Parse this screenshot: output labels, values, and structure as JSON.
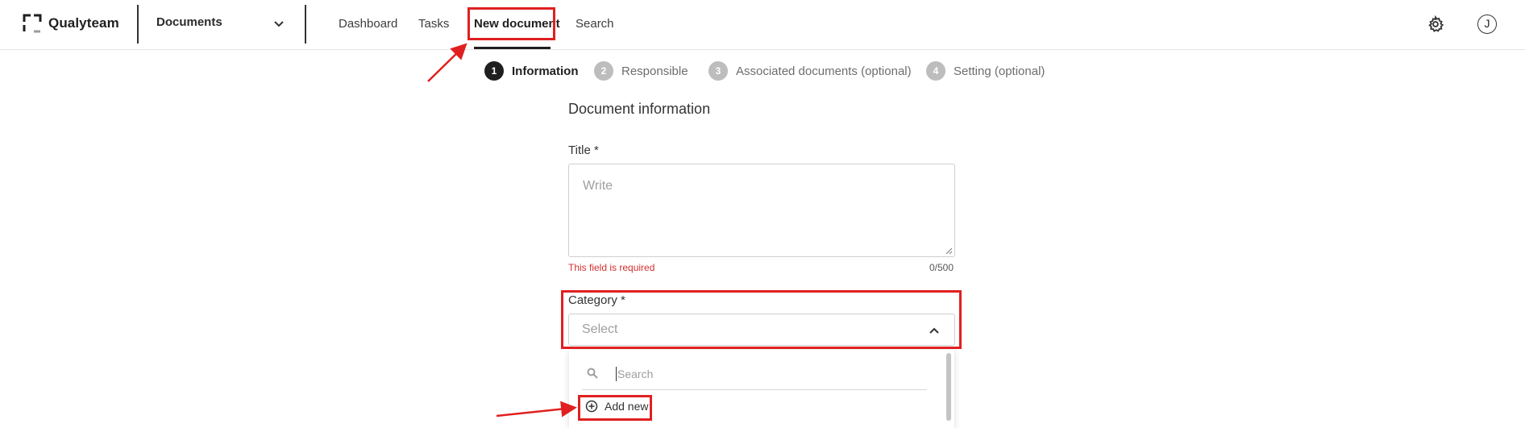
{
  "header": {
    "logo_text": "Qualyteam",
    "module": "Documents",
    "nav": [
      {
        "label": "Dashboard",
        "active": false
      },
      {
        "label": "Tasks",
        "active": false
      },
      {
        "label": "New document",
        "active": true
      },
      {
        "label": "Search",
        "active": false
      }
    ],
    "avatar_initial": "J",
    "icons": {
      "settings": "gear-icon",
      "module_toggle": "chevron-down-icon"
    }
  },
  "stepper": [
    {
      "num": "1",
      "label": "Information",
      "active": true
    },
    {
      "num": "2",
      "label": "Responsible",
      "active": false
    },
    {
      "num": "3",
      "label": "Associated documents (optional)",
      "active": false
    },
    {
      "num": "4",
      "label": "Setting (optional)",
      "active": false
    }
  ],
  "form": {
    "section_title": "Document information",
    "title_field": {
      "label": "Title *",
      "placeholder": "Write",
      "error": "This field is required",
      "counter": "0/500"
    },
    "category_field": {
      "label": "Category *",
      "placeholder": "Select",
      "dropdown": {
        "search_placeholder": "Search",
        "add_new_label": "Add new"
      }
    }
  },
  "colors": {
    "accent_dark": "#1f1f1f",
    "error": "#d32f2f",
    "annotation": "#e02020"
  }
}
